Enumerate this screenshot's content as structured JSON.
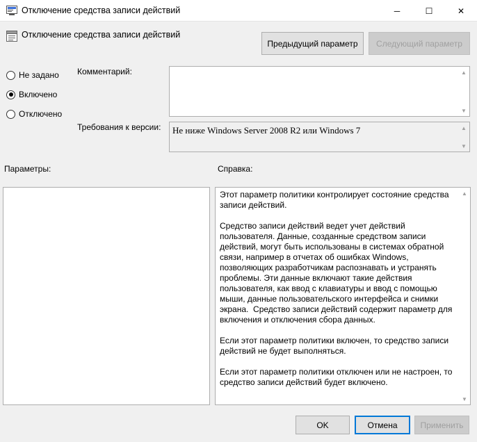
{
  "window": {
    "title": "Отключение средства записи действий",
    "icon": "policy-editor-icon",
    "controls": {
      "minimize": "─",
      "maximize": "☐",
      "close": "✕"
    }
  },
  "header": {
    "policy_name": "Отключение средства записи действий",
    "policy_icon": "policy-setting-icon",
    "prev_button": "Предыдущий параметр",
    "next_button": "Следующий параметр"
  },
  "state": {
    "options": [
      {
        "label": "Не задано",
        "checked": false
      },
      {
        "label": "Включено",
        "checked": true
      },
      {
        "label": "Отключено",
        "checked": false
      }
    ]
  },
  "comment": {
    "label": "Комментарий:",
    "value": ""
  },
  "version": {
    "label": "Требования к версии:",
    "value": "Не ниже Windows Server 2008 R2 или Windows 7"
  },
  "parameters": {
    "label": "Параметры:"
  },
  "help": {
    "label": "Справка:",
    "text": "Этот параметр политики контролирует состояние средства записи действий.\n\nСредство записи действий ведет учет действий пользователя. Данные, созданные средством записи действий, могут быть использованы в системах обратной связи, например в отчетах об ошибках Windows, позволяющих разработчикам распознавать и устранять проблемы. Эти данные включают такие действия пользователя, как ввод с клавиатуры и ввод с помощью мыши, данные пользовательского интерфейса и снимки экрана.  Средство записи действий содержит параметр для включения и отключения сбора данных.\n\nЕсли этот параметр политики включен, то средство записи действий не будет выполняться.\n\nЕсли этот параметр политики отключен или не настроен, то средство записи действий будет включено."
  },
  "footer": {
    "ok": "OK",
    "cancel": "Отмена",
    "apply": "Применить"
  }
}
